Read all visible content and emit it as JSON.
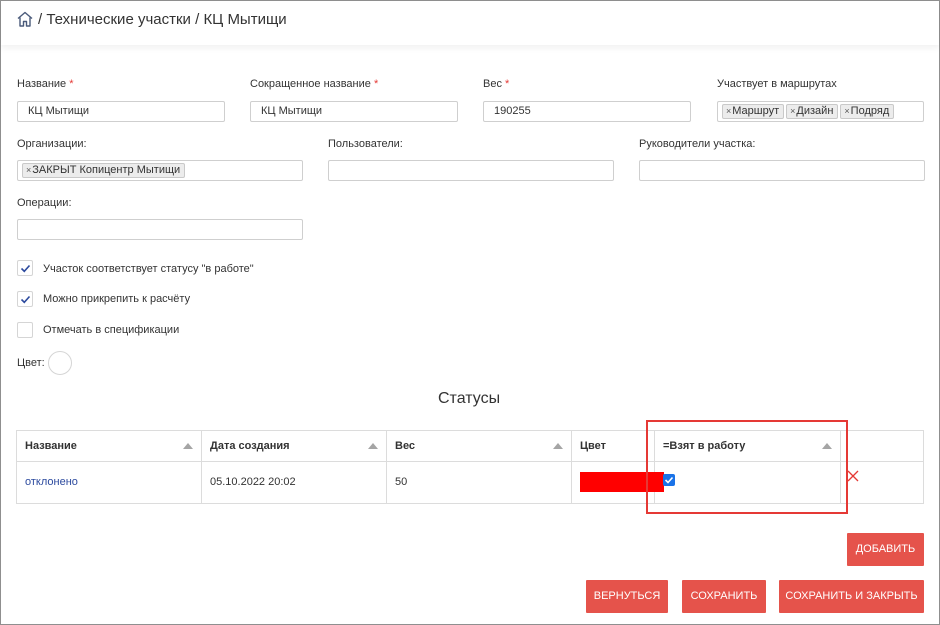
{
  "breadcrumb": {
    "separator": "/",
    "items": [
      "Технические участки",
      "КЦ Мытищи"
    ]
  },
  "form": {
    "name": {
      "label": "Название",
      "required_mark": "*",
      "value": "КЦ Мытищи"
    },
    "short_name": {
      "label": "Сокращенное название",
      "required_mark": "*",
      "value": "КЦ Мытищи"
    },
    "weight": {
      "label": "Вес",
      "required_mark": "*",
      "value": "190255"
    },
    "routes": {
      "label": "Участвует в маршрутах",
      "tags": [
        "Маршрут",
        "Дизайн",
        "Подряд"
      ]
    },
    "organizations": {
      "label": "Организации:",
      "tags": [
        "ЗАКРЫТ Копицентр Мытищи"
      ]
    },
    "users": {
      "label": "Пользователи:",
      "value": ""
    },
    "managers": {
      "label": "Руководители участка:",
      "value": ""
    },
    "operations": {
      "label": "Операции:",
      "value": ""
    },
    "checkboxes": [
      {
        "label": "Участок соответствует статусу \"в работе\"",
        "checked": true
      },
      {
        "label": "Можно прикрепить к расчёту",
        "checked": true
      },
      {
        "label": "Отмечать в спецификации",
        "checked": false
      }
    ],
    "color_label": "Цвет:"
  },
  "statuses": {
    "title": "Статусы",
    "columns": [
      "Название",
      "Дата создания",
      "Вес",
      "Цвет",
      "=Взят в работу"
    ],
    "rows": [
      {
        "name": "отклонено",
        "created": "05.10.2022 20:02",
        "weight": "50",
        "color": "#ff0000",
        "taken_to_work": true
      }
    ]
  },
  "icon_tag_remove": "×",
  "buttons": {
    "add": "ДОБАВИТЬ",
    "back": "ВЕРНУТЬСЯ",
    "save": "СОХРАНИТЬ",
    "save_close": "СОХРАНИТЬ И ЗАКРЫТЬ"
  },
  "colors": {
    "accent": "#e5534b",
    "link": "#2c4a9e",
    "checkbox": "#1a73e8",
    "highlight": "#e53935"
  }
}
